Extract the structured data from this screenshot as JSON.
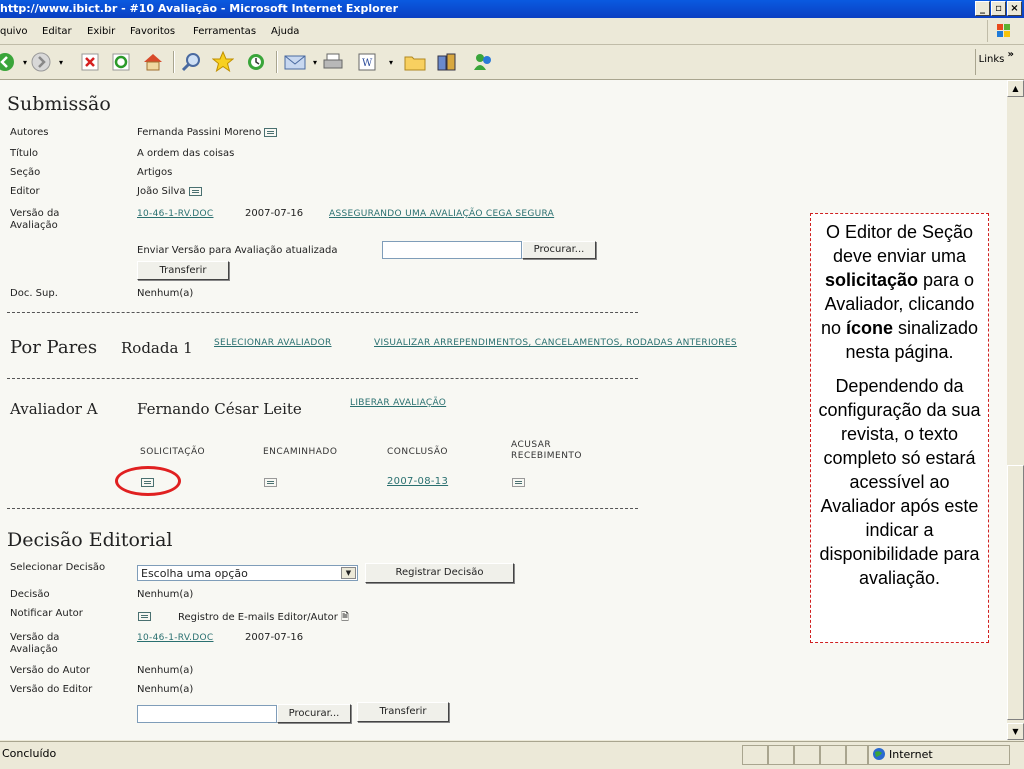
{
  "window": {
    "title": "http://www.ibict.br - #10 Avaliação - Microsoft Internet Explorer",
    "min": "_",
    "max": "▫",
    "close": "×"
  },
  "menu": [
    "quivo",
    "Editar",
    "Exibir",
    "Favoritos",
    "Ferramentas",
    "Ajuda"
  ],
  "toolbar": {
    "links_label": "Links",
    "chevron": "»"
  },
  "submissao": {
    "heading": "Submissão",
    "autores_label": "Autores",
    "autores_value": "Fernanda Passini Moreno",
    "titulo_label": "Título",
    "titulo_value": "A ordem das coisas",
    "secao_label": "Seção",
    "secao_value": "Artigos",
    "editor_label": "Editor",
    "editor_value": "João Silva",
    "versao_label": "Versão da Avaliação",
    "versao_file": "10-46-1-RV.DOC",
    "versao_date": "2007-07-16",
    "versao_link": "ASSEGURANDO UMA AVALIAÇÃO CEGA SEGURA",
    "enviar_label": "Enviar Versão para Avaliação atualizada",
    "procurar": "Procurar...",
    "transferir": "Transferir",
    "docsup_label": "Doc. Sup.",
    "docsup_value": "Nenhum(a)"
  },
  "porpares": {
    "heading": "Por Pares",
    "rodada": "Rodada 1",
    "selecionar": "SELECIONAR AVALIADOR",
    "visualizar": "VISUALIZAR ARREPENDIMENTOS, CANCELAMENTOS, RODADAS ANTERIORES"
  },
  "avaliador": {
    "label": "Avaliador A",
    "name": "Fernando César Leite",
    "liberar": "LIBERAR AVALIAÇÃO",
    "col_solicitacao": "SOLICITAÇÃO",
    "col_encaminhado": "ENCAMINHADO",
    "col_conclusao": "CONCLUSÃO",
    "col_acusar": "ACUSAR RECEBIMENTO",
    "conclusao_date": "2007-08-13"
  },
  "decisao": {
    "heading": "Decisão Editorial",
    "selecionar_label": "Selecionar Decisão",
    "select_value": "Escolha uma opção",
    "registrar": "Registrar Decisão",
    "decisao_label": "Decisão",
    "decisao_value": "Nenhum(a)",
    "notificar_label": "Notificar Autor",
    "registro_emails": "Registro de E-mails Editor/Autor",
    "versao_label": "Versão da Avaliação",
    "versao_file": "10-46-1-RV.DOC",
    "versao_date": "2007-07-16",
    "autor_label": "Versão do Autor",
    "autor_value": "Nenhum(a)",
    "editor_label": "Versão do Editor",
    "editor_value": "Nenhum(a)",
    "procurar": "Procurar...",
    "transferir": "Transferir"
  },
  "note": {
    "p1_a": "O Editor de Seção deve enviar uma ",
    "p1_b": "solicitação",
    "p1_c": " para o Avaliador, clicando no ",
    "p1_d": "ícone",
    "p1_e": " sinalizado nesta página.",
    "p2": "Dependendo da configuração da sua revista, o texto completo só estará acessível ao Avaliador após este indicar a disponibilidade para avaliação."
  },
  "status": {
    "left": "Concluído",
    "zone": "Internet"
  }
}
